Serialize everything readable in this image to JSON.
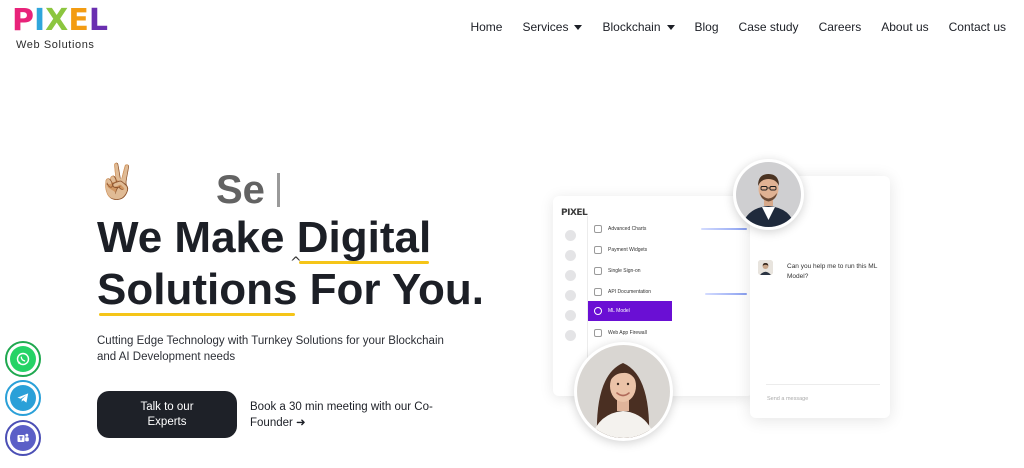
{
  "brand": {
    "logo_letters": [
      "P",
      "I",
      "X",
      "E",
      "L"
    ],
    "logo_colors": [
      "#e8237a",
      "#2fa6dc",
      "#8cc63f",
      "#f39c12",
      "#6a2fb0"
    ],
    "tagline": "Web Solutions"
  },
  "nav": {
    "items": [
      {
        "label": "Home",
        "has_dropdown": false
      },
      {
        "label": "Services",
        "has_dropdown": true
      },
      {
        "label": "Blockchain",
        "has_dropdown": true
      },
      {
        "label": "Blog",
        "has_dropdown": false
      },
      {
        "label": "Case study",
        "has_dropdown": false
      },
      {
        "label": "Careers",
        "has_dropdown": false
      },
      {
        "label": "About us",
        "has_dropdown": false
      },
      {
        "label": "Contact us",
        "has_dropdown": false
      }
    ]
  },
  "hero": {
    "emoji": "✌🏼",
    "typing_text": "Se",
    "headline_line1_a": "We Make ",
    "headline_line1_b": "Digital",
    "headline_line2_a": "Solutions",
    "headline_line2_b": " For You.",
    "subtext": "Cutting Edge Technology with Turnkey Solutions for your Blockchain and AI Development needs",
    "cta_label": "Talk to our Experts",
    "meeting_link": "Book a 30 min meeting with our Co-Founder ➜"
  },
  "social": {
    "whatsapp_icon": "whatsapp-icon",
    "telegram_icon": "telegram-icon",
    "teams_icon": "teams-icon"
  },
  "illustration": {
    "app_logo": "PIXEL",
    "menu_items": [
      {
        "label": "Advanced Charts",
        "active": false
      },
      {
        "label": "Payment Widgets",
        "active": false
      },
      {
        "label": "Single Sign-on",
        "active": false
      },
      {
        "label": "API Documentation",
        "active": false
      },
      {
        "label": "ML Model",
        "active": true
      },
      {
        "label": "Web App Firewall",
        "active": false
      }
    ],
    "chat_message": "Can you help me to run this ML Model?",
    "chat_placeholder": "Send a message"
  },
  "colors": {
    "accent_yellow": "#f5c518",
    "cta_bg": "#1e2128",
    "active_menu": "#6a0fd4"
  }
}
